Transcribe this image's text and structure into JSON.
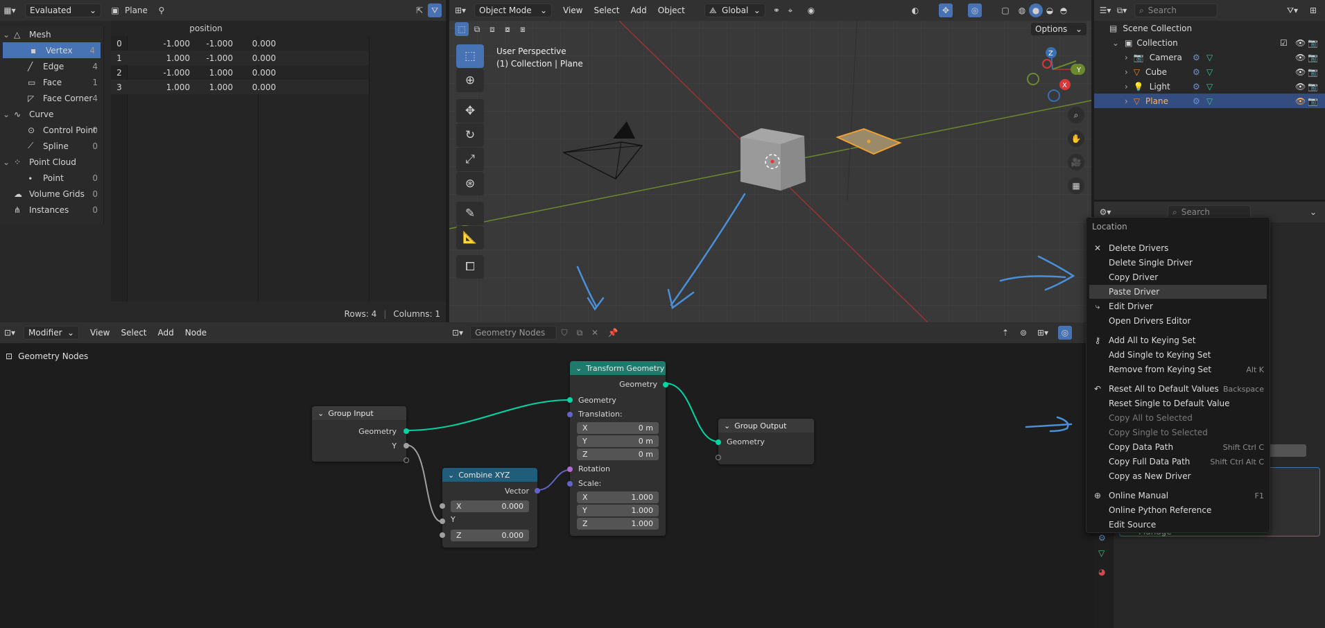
{
  "spreadsheet": {
    "header": {
      "evaluated_label": "Evaluated",
      "object_label": "Plane"
    },
    "tree": [
      {
        "label": "Mesh",
        "count": "",
        "level": 0
      },
      {
        "label": "Vertex",
        "count": "4",
        "level": 1,
        "selected": true
      },
      {
        "label": "Edge",
        "count": "4",
        "level": 1
      },
      {
        "label": "Face",
        "count": "1",
        "level": 1
      },
      {
        "label": "Face Corner",
        "count": "4",
        "level": 1
      },
      {
        "label": "Curve",
        "count": "",
        "level": 0
      },
      {
        "label": "Control Point",
        "count": "0",
        "level": 1
      },
      {
        "label": "Spline",
        "count": "0",
        "level": 1
      },
      {
        "label": "Point Cloud",
        "count": "",
        "level": 0
      },
      {
        "label": "Point",
        "count": "0",
        "level": 1
      },
      {
        "label": "Volume Grids",
        "count": "0",
        "level": 0
      },
      {
        "label": "Instances",
        "count": "0",
        "level": 0
      }
    ],
    "column_header": "position",
    "rows": [
      {
        "idx": "0",
        "x": "-1.000",
        "y": "-1.000",
        "z": "0.000"
      },
      {
        "idx": "1",
        "x": "1.000",
        "y": "-1.000",
        "z": "0.000"
      },
      {
        "idx": "2",
        "x": "-1.000",
        "y": "1.000",
        "z": "0.000"
      },
      {
        "idx": "3",
        "x": "1.000",
        "y": "1.000",
        "z": "0.000"
      }
    ],
    "footer": {
      "rows": "Rows: 4",
      "columns": "Columns: 1"
    }
  },
  "viewport": {
    "header": {
      "mode": "Object Mode",
      "menus": [
        "View",
        "Select",
        "Add",
        "Object"
      ],
      "orientation": "Global"
    },
    "options_label": "Options",
    "overlay_line1": "User Perspective",
    "overlay_line2": "(1) Collection | Plane",
    "gizmo": {
      "x": "X",
      "y": "Y",
      "z": "Z"
    }
  },
  "outliner": {
    "search_placeholder": "Search",
    "scene_collection": "Scene Collection",
    "collection": "Collection",
    "items": [
      {
        "label": "Camera"
      },
      {
        "label": "Cube"
      },
      {
        "label": "Light"
      },
      {
        "label": "Plane",
        "selected": true
      }
    ]
  },
  "properties": {
    "search_placeholder": "Search",
    "manage_label": "Manage"
  },
  "node_editor": {
    "header": {
      "mode": "Modifier",
      "menus": [
        "View",
        "Select",
        "Add",
        "Node"
      ],
      "tree_name": "Geometry Nodes"
    },
    "breadcrumb": "Geometry Nodes",
    "nodes": {
      "group_input": {
        "title": "Group Input",
        "geometry": "Geometry",
        "y": "Y"
      },
      "combine_xyz": {
        "title": "Combine XYZ",
        "vector": "Vector",
        "x_label": "X",
        "x_value": "0.000",
        "y_label": "Y",
        "z_label": "Z",
        "z_value": "0.000"
      },
      "transform": {
        "title": "Transform Geometry",
        "geometry_out": "Geometry",
        "geometry_in": "Geometry",
        "translation": "Translation:",
        "tx_label": "X",
        "tx": "0 m",
        "ty_label": "Y",
        "ty": "0 m",
        "tz_label": "Z",
        "tz": "0 m",
        "rotation": "Rotation",
        "scale": "Scale:",
        "sx_label": "X",
        "sx": "1.000",
        "sy_label": "Y",
        "sy": "1.000",
        "sz_label": "Z",
        "sz": "1.000"
      },
      "group_output": {
        "title": "Group Output",
        "geometry": "Geometry"
      }
    }
  },
  "context_menu": {
    "title": "Location",
    "items": [
      {
        "label": "Delete Drivers",
        "icon": "close-icon"
      },
      {
        "label": "Delete Single Driver"
      },
      {
        "label": "Copy Driver"
      },
      {
        "label": "Paste Driver",
        "highlighted": true
      },
      {
        "label": "Edit Driver",
        "icon": "driver-icon"
      },
      {
        "label": "Open Drivers Editor"
      },
      {
        "label": "Add All to Keying Set",
        "icon": "keyingset-icon"
      },
      {
        "label": "Add Single to Keying Set"
      },
      {
        "label": "Remove from Keying Set",
        "shortcut": "Alt K"
      },
      {
        "label": "Reset All to Default Values",
        "icon": "reset-icon",
        "shortcut": "Backspace"
      },
      {
        "label": "Reset Single to Default Value"
      },
      {
        "label": "Copy All to Selected",
        "disabled": true
      },
      {
        "label": "Copy Single to Selected",
        "disabled": true
      },
      {
        "label": "Copy Data Path",
        "shortcut": "Shift Ctrl C"
      },
      {
        "label": "Copy Full Data Path",
        "shortcut": "Shift Ctrl Alt C"
      },
      {
        "label": "Copy as New Driver"
      },
      {
        "label": "Online Manual",
        "icon": "globe-icon",
        "shortcut": "F1"
      },
      {
        "label": "Online Python Reference"
      },
      {
        "label": "Edit Source"
      }
    ]
  },
  "colors": {
    "accent": "#4772b3",
    "node_geometry_socket": "#00d6a3",
    "node_vector_socket": "#6363c7",
    "transform_header": "#1e7a6a",
    "combine_header": "#1f5d7a"
  }
}
